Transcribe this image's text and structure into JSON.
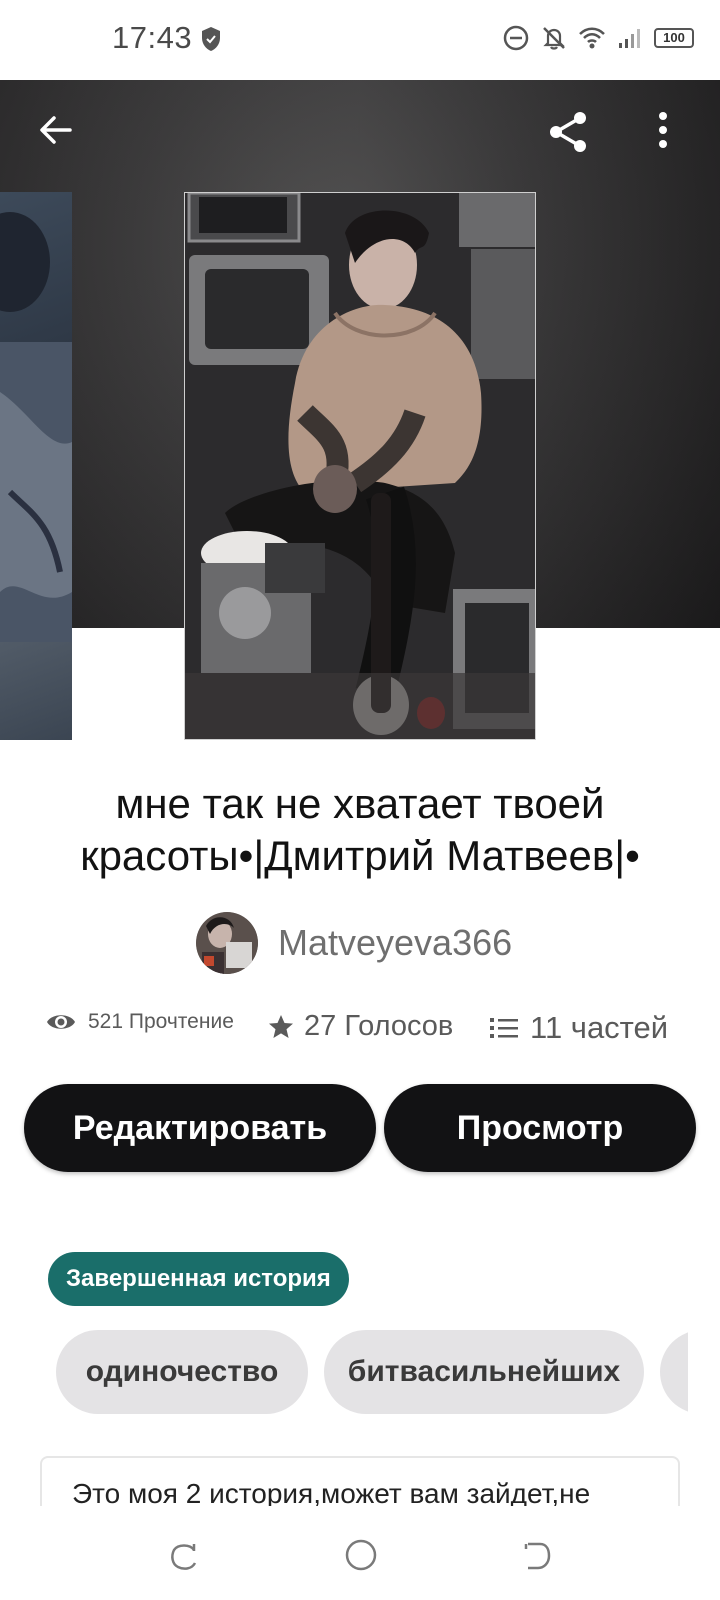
{
  "status_bar": {
    "time": "17:43",
    "battery": "100",
    "icons": [
      "shield-icon",
      "dnd-icon",
      "bell-off-icon",
      "wifi-icon",
      "signal-icon",
      "battery-icon"
    ]
  },
  "header": {
    "back_icon": "arrow-left-icon",
    "share_icon": "share-icon",
    "more_icon": "more-vertical-icon"
  },
  "story": {
    "title": "мне так не хватает твоей красоты•|Дмитрий Матвеев|•",
    "author": "Matveyeva366"
  },
  "stats": {
    "reads": "521 Прочтение",
    "votes": "27 Голосов",
    "parts": "11 частей"
  },
  "actions": {
    "edit_label": "Редактировать",
    "view_label": "Просмотр"
  },
  "completion_tag": "Завершенная история",
  "tags": [
    "одиночество",
    "битвасильнейших",
    ""
  ],
  "description": "Это моя 2 история,может вам зайдет,не",
  "nav": {
    "recent_icon": "recents-icon",
    "home_icon": "home-icon",
    "back_icon": "back-icon"
  },
  "colors": {
    "button_bg": "#121214",
    "tag_completed": "#1a6e6a",
    "tag_bg": "#e4e3e5"
  }
}
